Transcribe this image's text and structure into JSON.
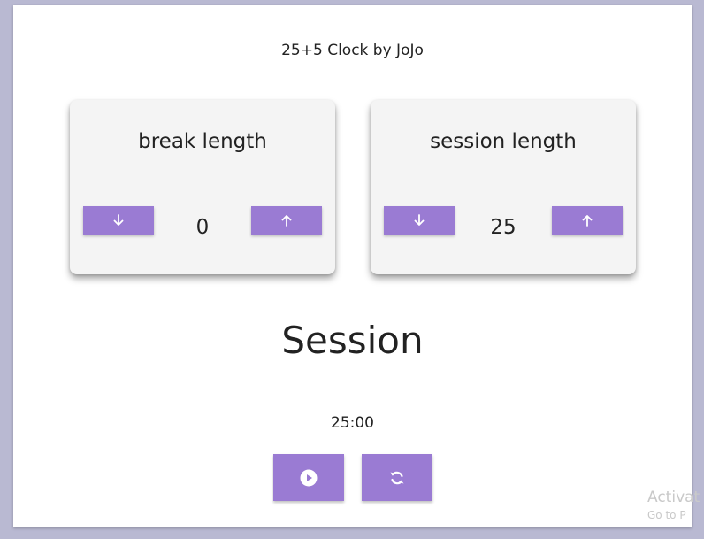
{
  "app": {
    "title": "25+5 Clock by JoJo"
  },
  "break": {
    "title": "break length",
    "value": "0",
    "decrement_icon": "arrow-down-icon",
    "increment_icon": "arrow-up-icon"
  },
  "session": {
    "title": "session length",
    "value": "25",
    "decrement_icon": "arrow-down-icon",
    "increment_icon": "arrow-up-icon"
  },
  "timer": {
    "label": "Session",
    "time": "25:00"
  },
  "controls": {
    "play_icon": "play-circle-icon",
    "reset_icon": "refresh-icon"
  },
  "watermark": {
    "line1": "Activat",
    "line2": "Go to P"
  },
  "colors": {
    "accent": "#9a7bd3",
    "card_bg": "#f4f4f4",
    "page_bg": "#b9b9d2"
  }
}
